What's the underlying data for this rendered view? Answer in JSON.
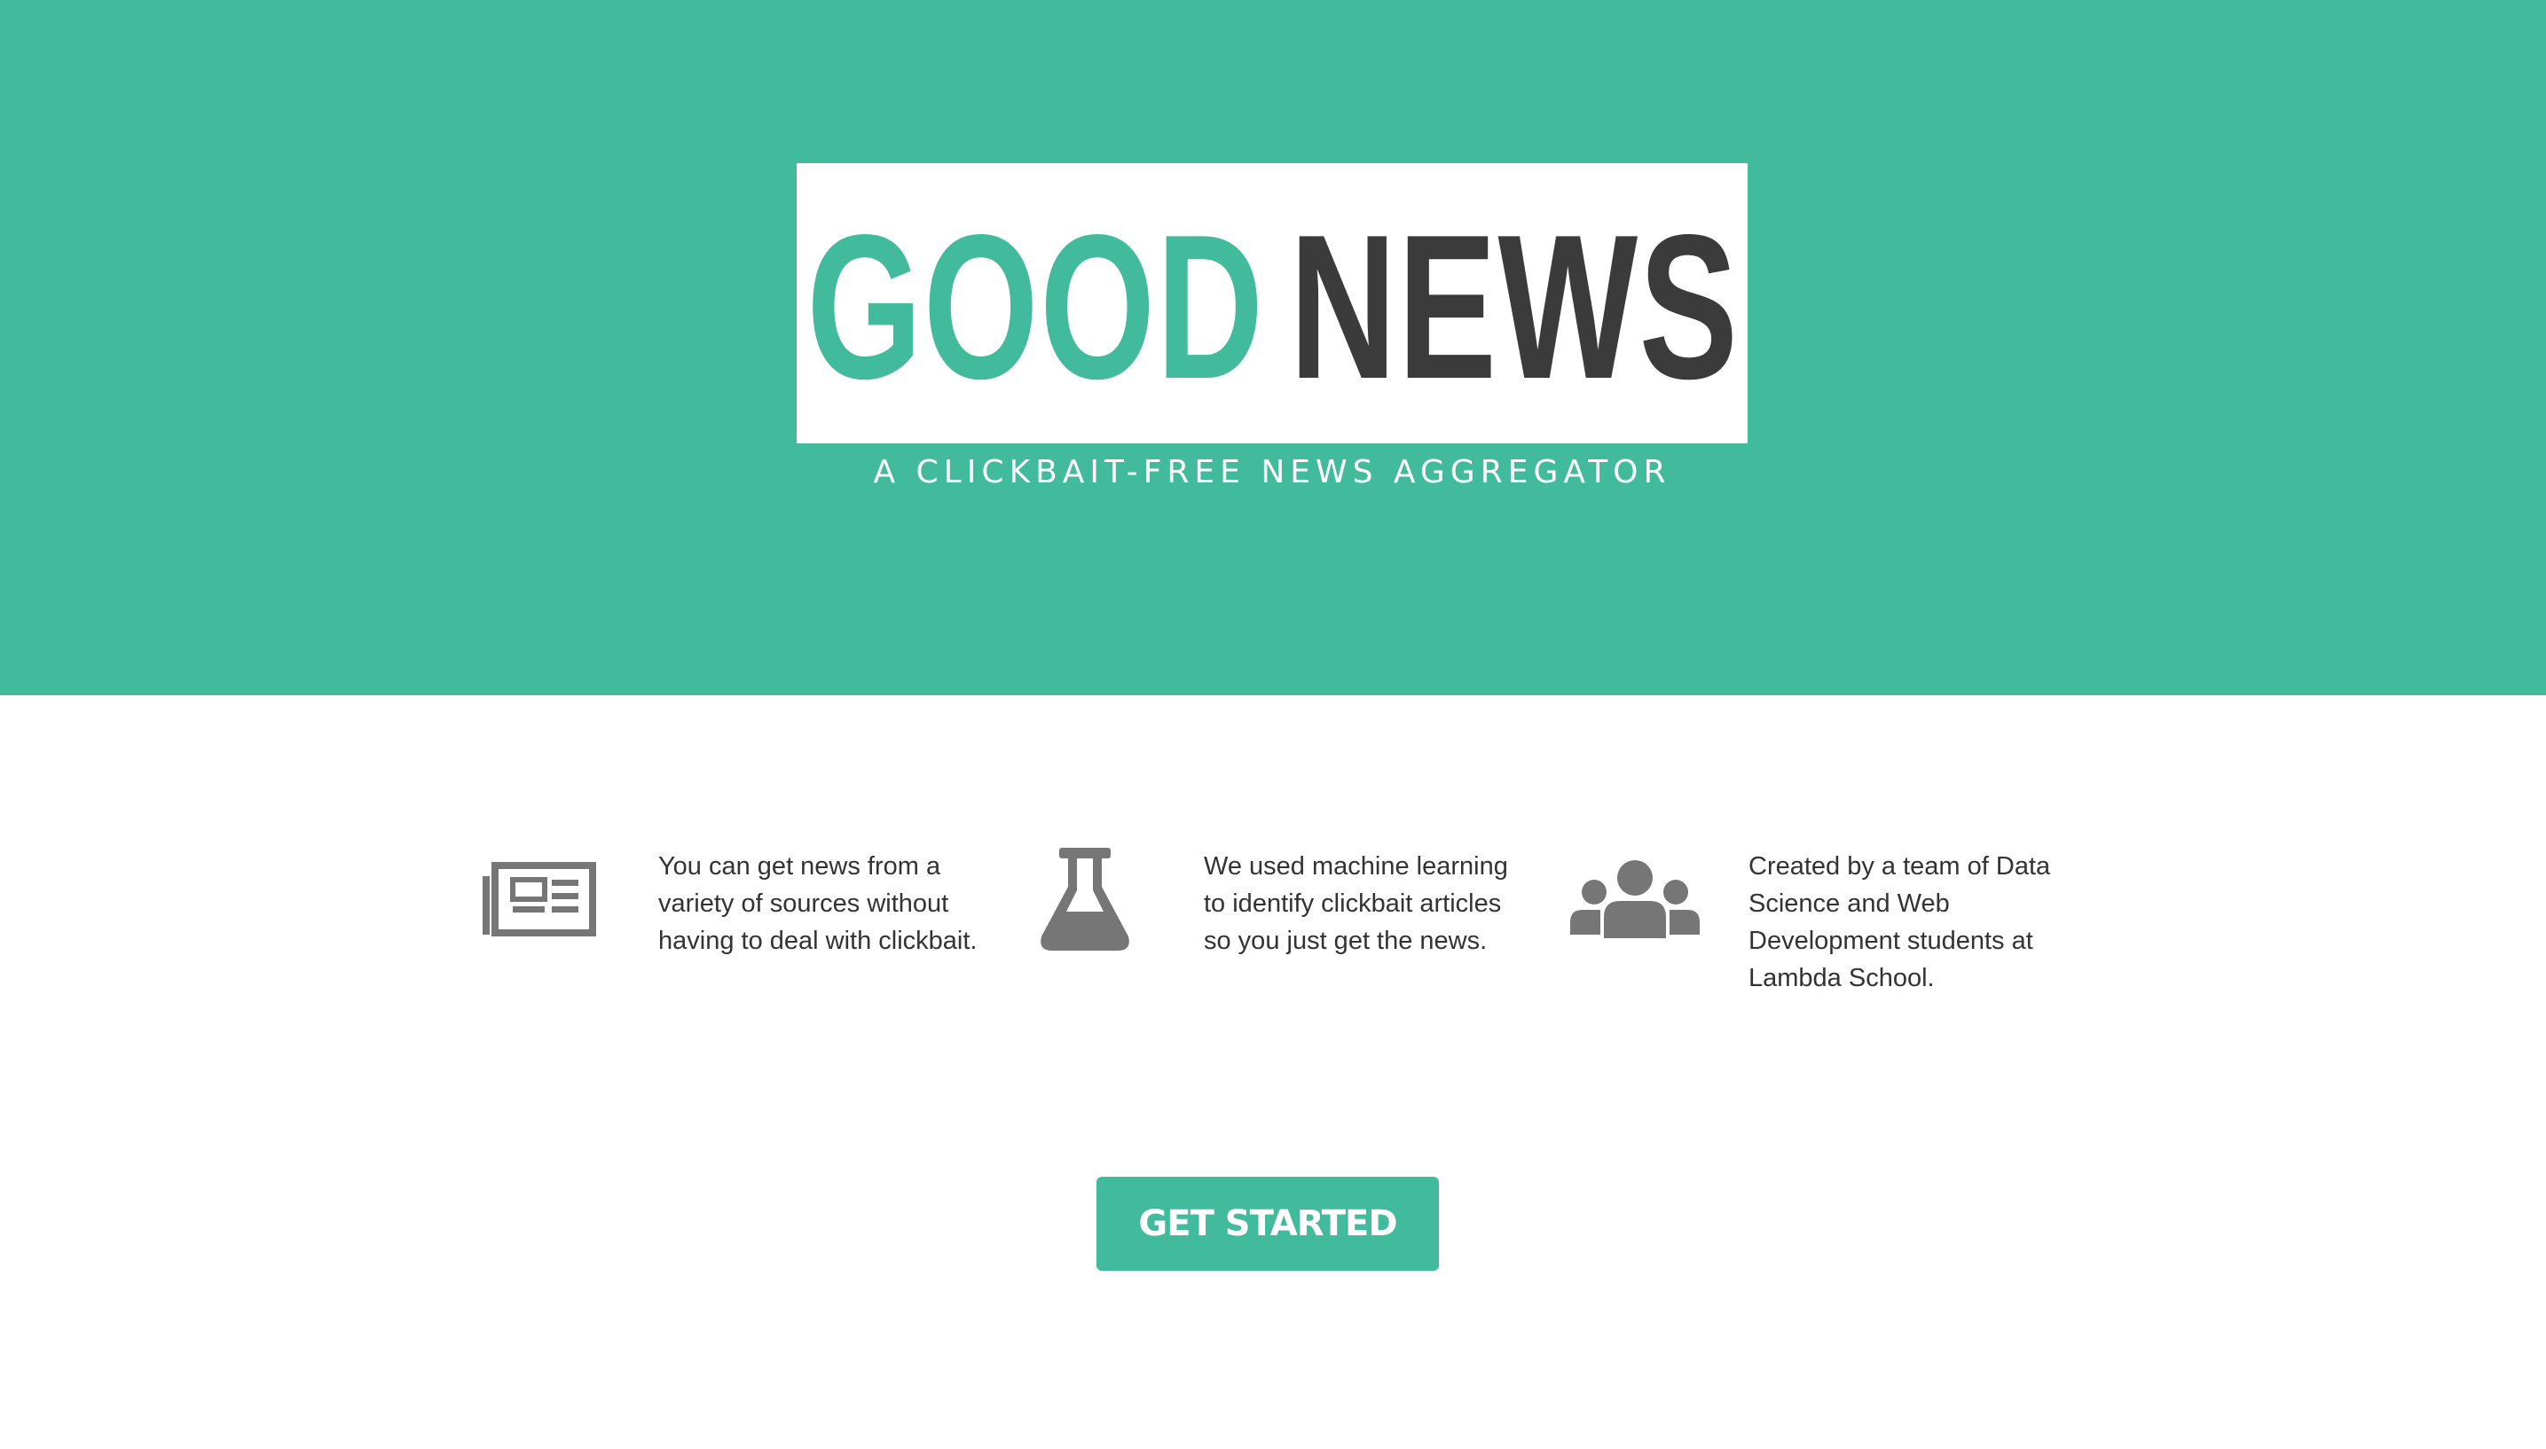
{
  "hero": {
    "logo_word_1": "GOOD",
    "logo_word_2": "NEWS",
    "tagline": "A CLICKBAIT-FREE NEWS AGGREGATOR"
  },
  "features": [
    {
      "icon": "newspaper-icon",
      "text": "You can get news from a variety of sources without having to deal with clickbait."
    },
    {
      "icon": "flask-icon",
      "text": "We used machine learning to identify clickbait articles so you just get the news."
    },
    {
      "icon": "users-icon",
      "text": "Created by a team of Data Science and Web Development students at Lambda School."
    }
  ],
  "cta": {
    "label": "GET STARTED"
  },
  "colors": {
    "brand": "#41bb9c",
    "dark": "#3b3b3b",
    "icon": "#767676"
  }
}
